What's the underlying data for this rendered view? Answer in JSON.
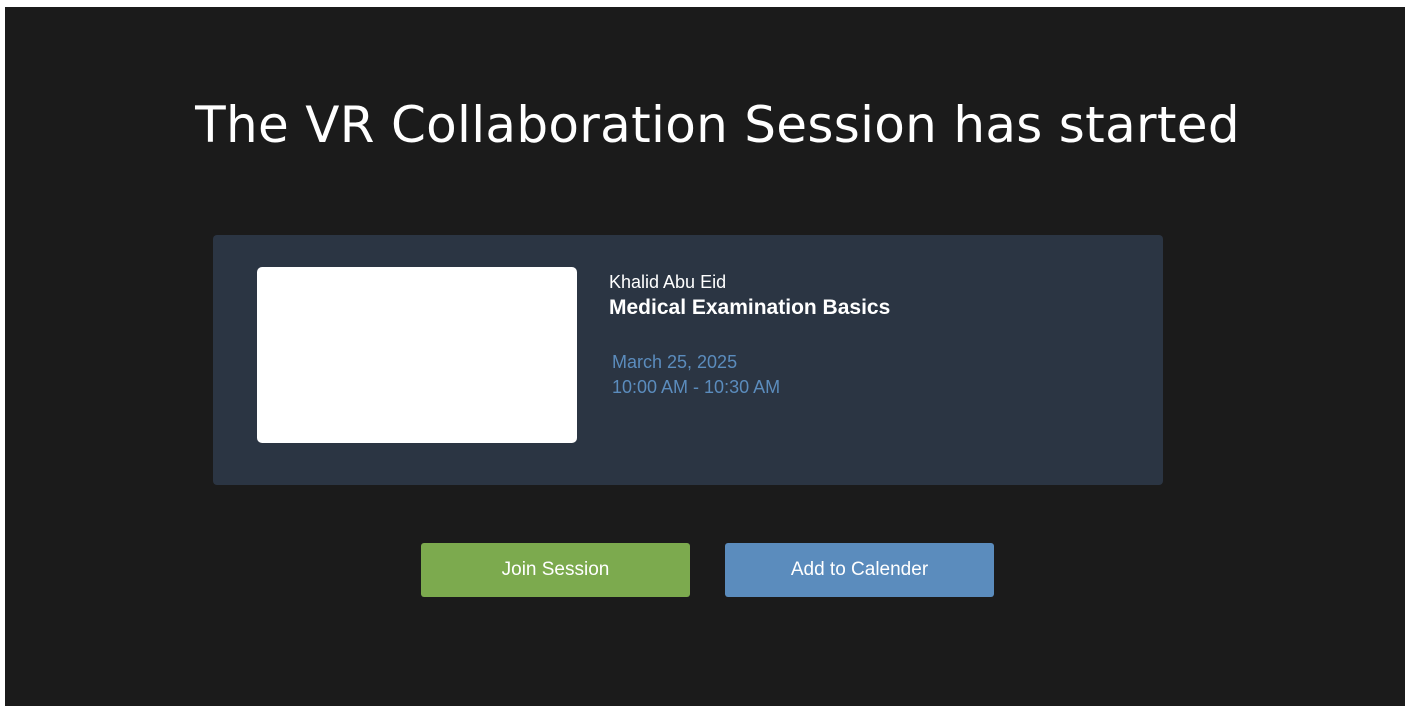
{
  "page": {
    "title": "The VR Collaboration Session has started"
  },
  "session": {
    "host": "Khalid Abu Eid",
    "course": "Medical Examination Basics",
    "date": "March 25, 2025",
    "time": "10:00 AM - 10:30 AM"
  },
  "actions": {
    "join_label": "Join Session",
    "calendar_label": "Add to Calender"
  },
  "colors": {
    "background": "#1b1b1b",
    "card": "#2b3543",
    "join_button": "#7caa4e",
    "calendar_button": "#5b8cbd",
    "date_text": "#5b8cbd"
  }
}
